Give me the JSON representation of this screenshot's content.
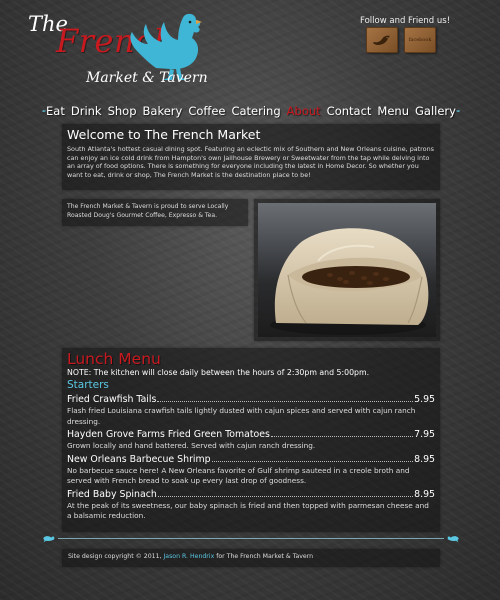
{
  "logo": {
    "the": "The",
    "french": "French",
    "sub": "Market & Tavern"
  },
  "social": {
    "heading": "Follow and Friend us!",
    "twitter_icon": "twitter-bird-icon",
    "facebook_label": "facebook"
  },
  "nav": {
    "items": [
      {
        "label": "Eat"
      },
      {
        "label": "Drink"
      },
      {
        "label": "Shop"
      },
      {
        "label": "Bakery"
      },
      {
        "label": "Coffee"
      },
      {
        "label": "Catering"
      },
      {
        "label": "About"
      },
      {
        "label": "Contact"
      },
      {
        "label": "Menu"
      },
      {
        "label": "Gallery"
      }
    ],
    "active": "About"
  },
  "welcome": {
    "title": "Welcome to The French Market",
    "body": "South Atlanta's hottest casual dining spot. Featuring an eclectic mix of Southern and New Orleans cuisine, patrons can enjoy an ice cold drink from Hampton's own Jailhouse Brewery or Sweetwater from the tap while delving into an array of food options. There is something for everyone including the latest in Home Decor. So whether you want to eat, drink or shop, The French Market is the destination place to be!"
  },
  "coffee_note": "The French Market & Tavern is proud to serve Locally Roasted Doug's Gourmet Coffee, Expresso & Tea.",
  "menu": {
    "title": "Lunch Menu",
    "note": "NOTE: The kitchen will close daily between the hours of 2:30pm and 5:00pm.",
    "section": "Starters",
    "items": [
      {
        "name": "Fried Crawfish Tails",
        "price": "5.95",
        "desc": "Flash fried Louisiana crawfish tails lightly dusted with cajun spices and served with cajun ranch dressing."
      },
      {
        "name": "Hayden Grove Farms Fried Green Tomatoes",
        "price": "7.95",
        "desc": "Grown locally and hand battered.  Served with cajun ranch dressing."
      },
      {
        "name": "New Orleans Barbecue Shrimp",
        "price": "8.95",
        "desc": "No barbecue sauce here! A New Orleans favorite of Gulf shrimp sauteed in a creole broth and served with French bread to soak up every last drop of goodness."
      },
      {
        "name": "Fried Baby Spinach",
        "price": "8.95",
        "desc": "At the peak of its sweetness, our baby spinach is fried and then topped with parmesan cheese and a balsamic reduction."
      }
    ]
  },
  "footer": {
    "prefix": "Site design copyright © 2011,",
    "author": "Jason R. Hendrix",
    "suffix": "for The French Market & Tavern"
  },
  "colors": {
    "accent_red": "#c8191f",
    "accent_blue": "#5bc8e3",
    "rooster": "#3fb6d6"
  }
}
